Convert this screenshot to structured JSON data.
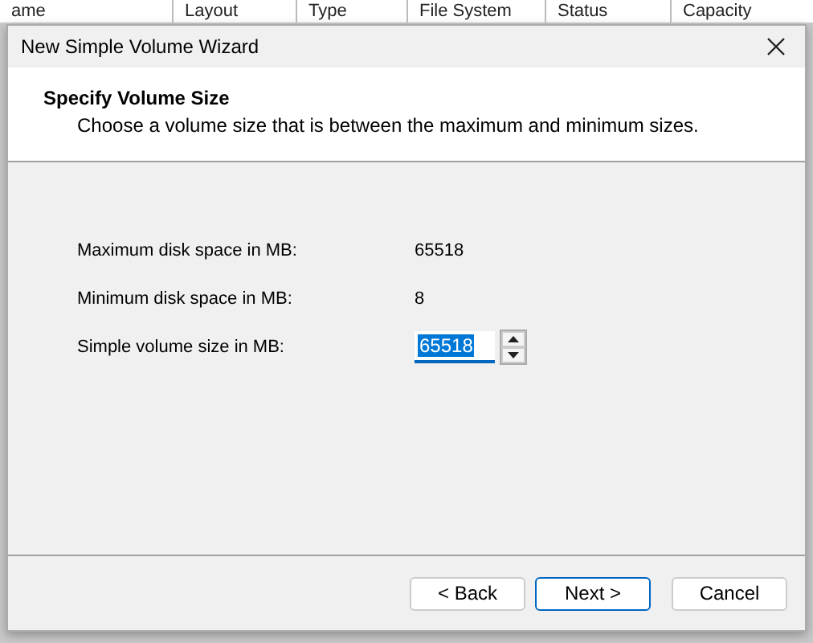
{
  "background_table": {
    "columns": [
      "ame",
      "Layout",
      "Type",
      "File System",
      "Status",
      "Capacity"
    ]
  },
  "dialog": {
    "title": "New Simple Volume Wizard",
    "heading": "Specify Volume Size",
    "subheading": "Choose a volume size that is between the maximum and minimum sizes.",
    "fields": [
      {
        "kind": "readout",
        "label": "Maximum disk space in MB:",
        "value": "65518"
      },
      {
        "kind": "readout",
        "label": "Minimum disk space in MB:",
        "value": "8"
      },
      {
        "kind": "spinner",
        "label": "Simple volume size in MB:",
        "value": "65518",
        "text_selected": true
      }
    ],
    "buttons": [
      {
        "label": "< Back",
        "default": false
      },
      {
        "label": "Next >",
        "default": true
      },
      {
        "label": "Cancel",
        "default": false
      }
    ]
  }
}
